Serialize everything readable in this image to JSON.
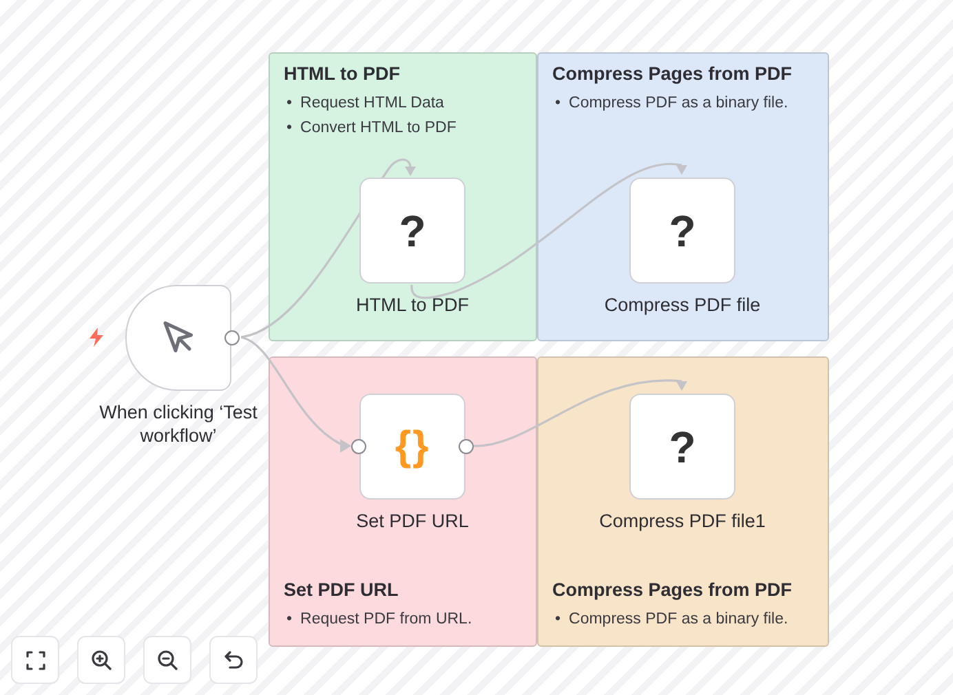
{
  "sticky_notes": [
    {
      "title": "HTML to PDF",
      "items": [
        {
          "bullet": "•",
          "text": "Request HTML Data"
        },
        {
          "bullet": "•",
          "text": "Convert HTML to PDF"
        }
      ],
      "color": "#d6f3e2"
    },
    {
      "title": "Compress Pages from PDF",
      "items": [
        {
          "bullet": "•",
          "text": "Compress PDF as a binary file."
        }
      ],
      "color": "#dce8f8"
    },
    {
      "title": "Set PDF URL",
      "items": [
        {
          "bullet": "•",
          "text": "Request PDF from URL."
        }
      ],
      "color": "#fcdade"
    },
    {
      "title": "Compress Pages from PDF",
      "items": [
        {
          "bullet": "•",
          "text": "Compress PDF as a binary file."
        }
      ],
      "color": "#f8e4c8"
    }
  ],
  "nodes": [
    {
      "kind": "trigger",
      "label": "When clicking ‘Test workflow’"
    },
    {
      "kind": "unknown",
      "glyph": "?",
      "label": "HTML to PDF"
    },
    {
      "kind": "unknown",
      "glyph": "?",
      "label": "Compress PDF file"
    },
    {
      "kind": "code",
      "glyph": "{}",
      "label": "Set PDF URL"
    },
    {
      "kind": "unknown",
      "glyph": "?",
      "label": "Compress PDF file1"
    }
  ]
}
